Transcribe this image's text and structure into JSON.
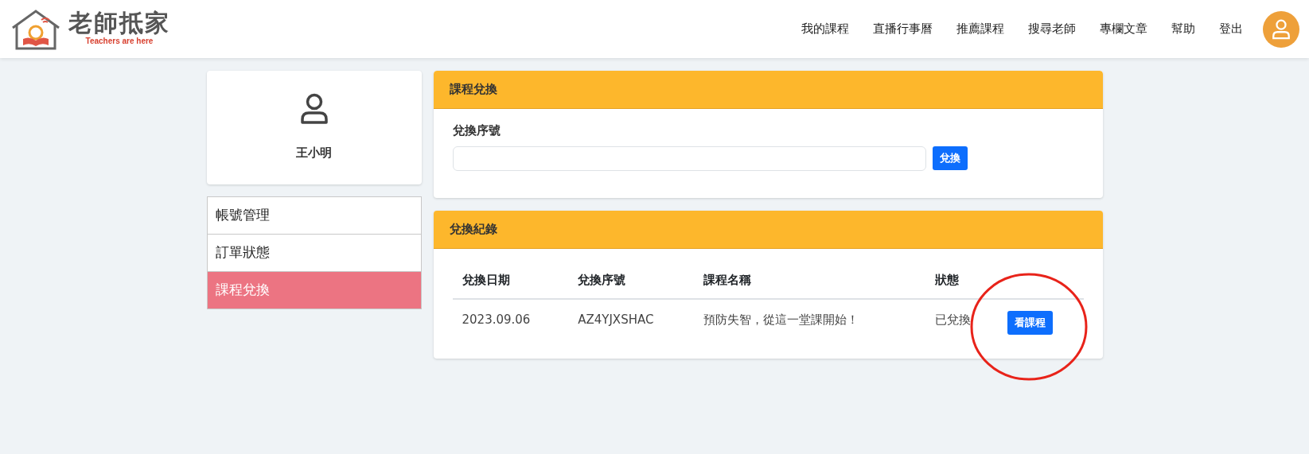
{
  "logo": {
    "title": "老師抵家",
    "tagline": "Teachers are here"
  },
  "nav": [
    "我的課程",
    "直播行事曆",
    "推薦課程",
    "搜尋老師",
    "專欄文章",
    "幫助",
    "登出"
  ],
  "profile": {
    "name": "王小明"
  },
  "sidebar": {
    "items": [
      {
        "label": "帳號管理",
        "selected": false
      },
      {
        "label": "訂單狀態",
        "selected": false
      },
      {
        "label": "課程兌換",
        "selected": true
      }
    ]
  },
  "redeem": {
    "title": "課程兌換",
    "field_label": "兌換序號",
    "button": "兌換"
  },
  "history": {
    "title": "兌換紀錄",
    "columns": [
      "兌換日期",
      "兌換序號",
      "課程名稱",
      "狀態"
    ],
    "rows": [
      {
        "date": "2023.09.06",
        "code": "AZ4YJXSHAC",
        "course": "預防失智，從這一堂課開始！",
        "status": "已兌換",
        "action": "看課程",
        "highlighted": true
      }
    ]
  }
}
